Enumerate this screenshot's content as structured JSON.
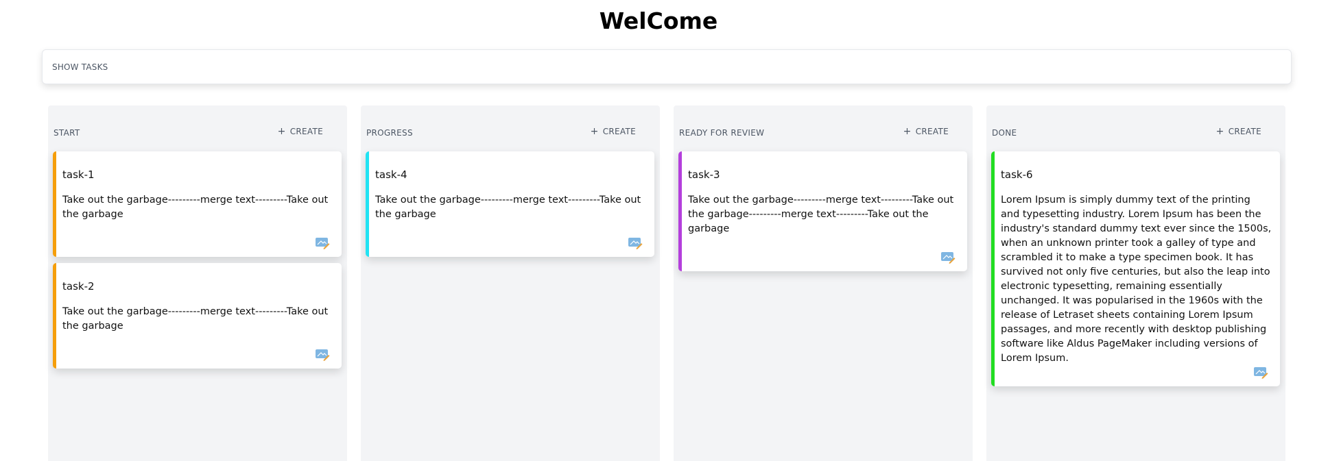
{
  "page": {
    "title": "WelCome"
  },
  "toolbar": {
    "show_tasks_label": "SHOW TASKS"
  },
  "colors": {
    "start": "#f59e0b",
    "progress": "#22e3f3",
    "review": "#b43fdc",
    "done": "#22dd22",
    "column_bg": "#f3f4f6"
  },
  "columns": [
    {
      "title": "START",
      "create_label": "CREATE",
      "cards": [
        {
          "name": "task-1",
          "description": "Take out the garbage---------merge text---------Take out the garbage",
          "icon": "edit-icon"
        },
        {
          "name": "task-2",
          "description": "Take out the garbage---------merge text---------Take out the garbage",
          "icon": "edit-icon"
        }
      ]
    },
    {
      "title": "PROGRESS",
      "create_label": "CREATE",
      "cards": [
        {
          "name": "task-4",
          "description": "Take out the garbage---------merge text---------Take out the garbage",
          "icon": "edit-icon"
        }
      ]
    },
    {
      "title": "READY FOR REVIEW",
      "create_label": "CREATE",
      "cards": [
        {
          "name": "task-3",
          "description": "Take out the garbage---------merge text---------Take out the garbage---------merge text---------Take out the garbage",
          "icon": "edit-icon"
        }
      ]
    },
    {
      "title": "DONE",
      "create_label": "CREATE",
      "cards": [
        {
          "name": "task-6",
          "description": "Lorem Ipsum is simply dummy text of the printing and typesetting industry. Lorem Ipsum has been the industry's standard dummy text ever since the 1500s, when an unknown printer took a galley of type and scrambled it to make a type specimen book. It has survived not only five centuries, but also the leap into electronic typesetting, remaining essentially unchanged. It was popularised in the 1960s with the release of Letraset sheets containing Lorem Ipsum passages, and more recently with desktop publishing software like Aldus PageMaker including versions of Lorem Ipsum.",
          "icon": "edit-icon"
        }
      ]
    }
  ]
}
